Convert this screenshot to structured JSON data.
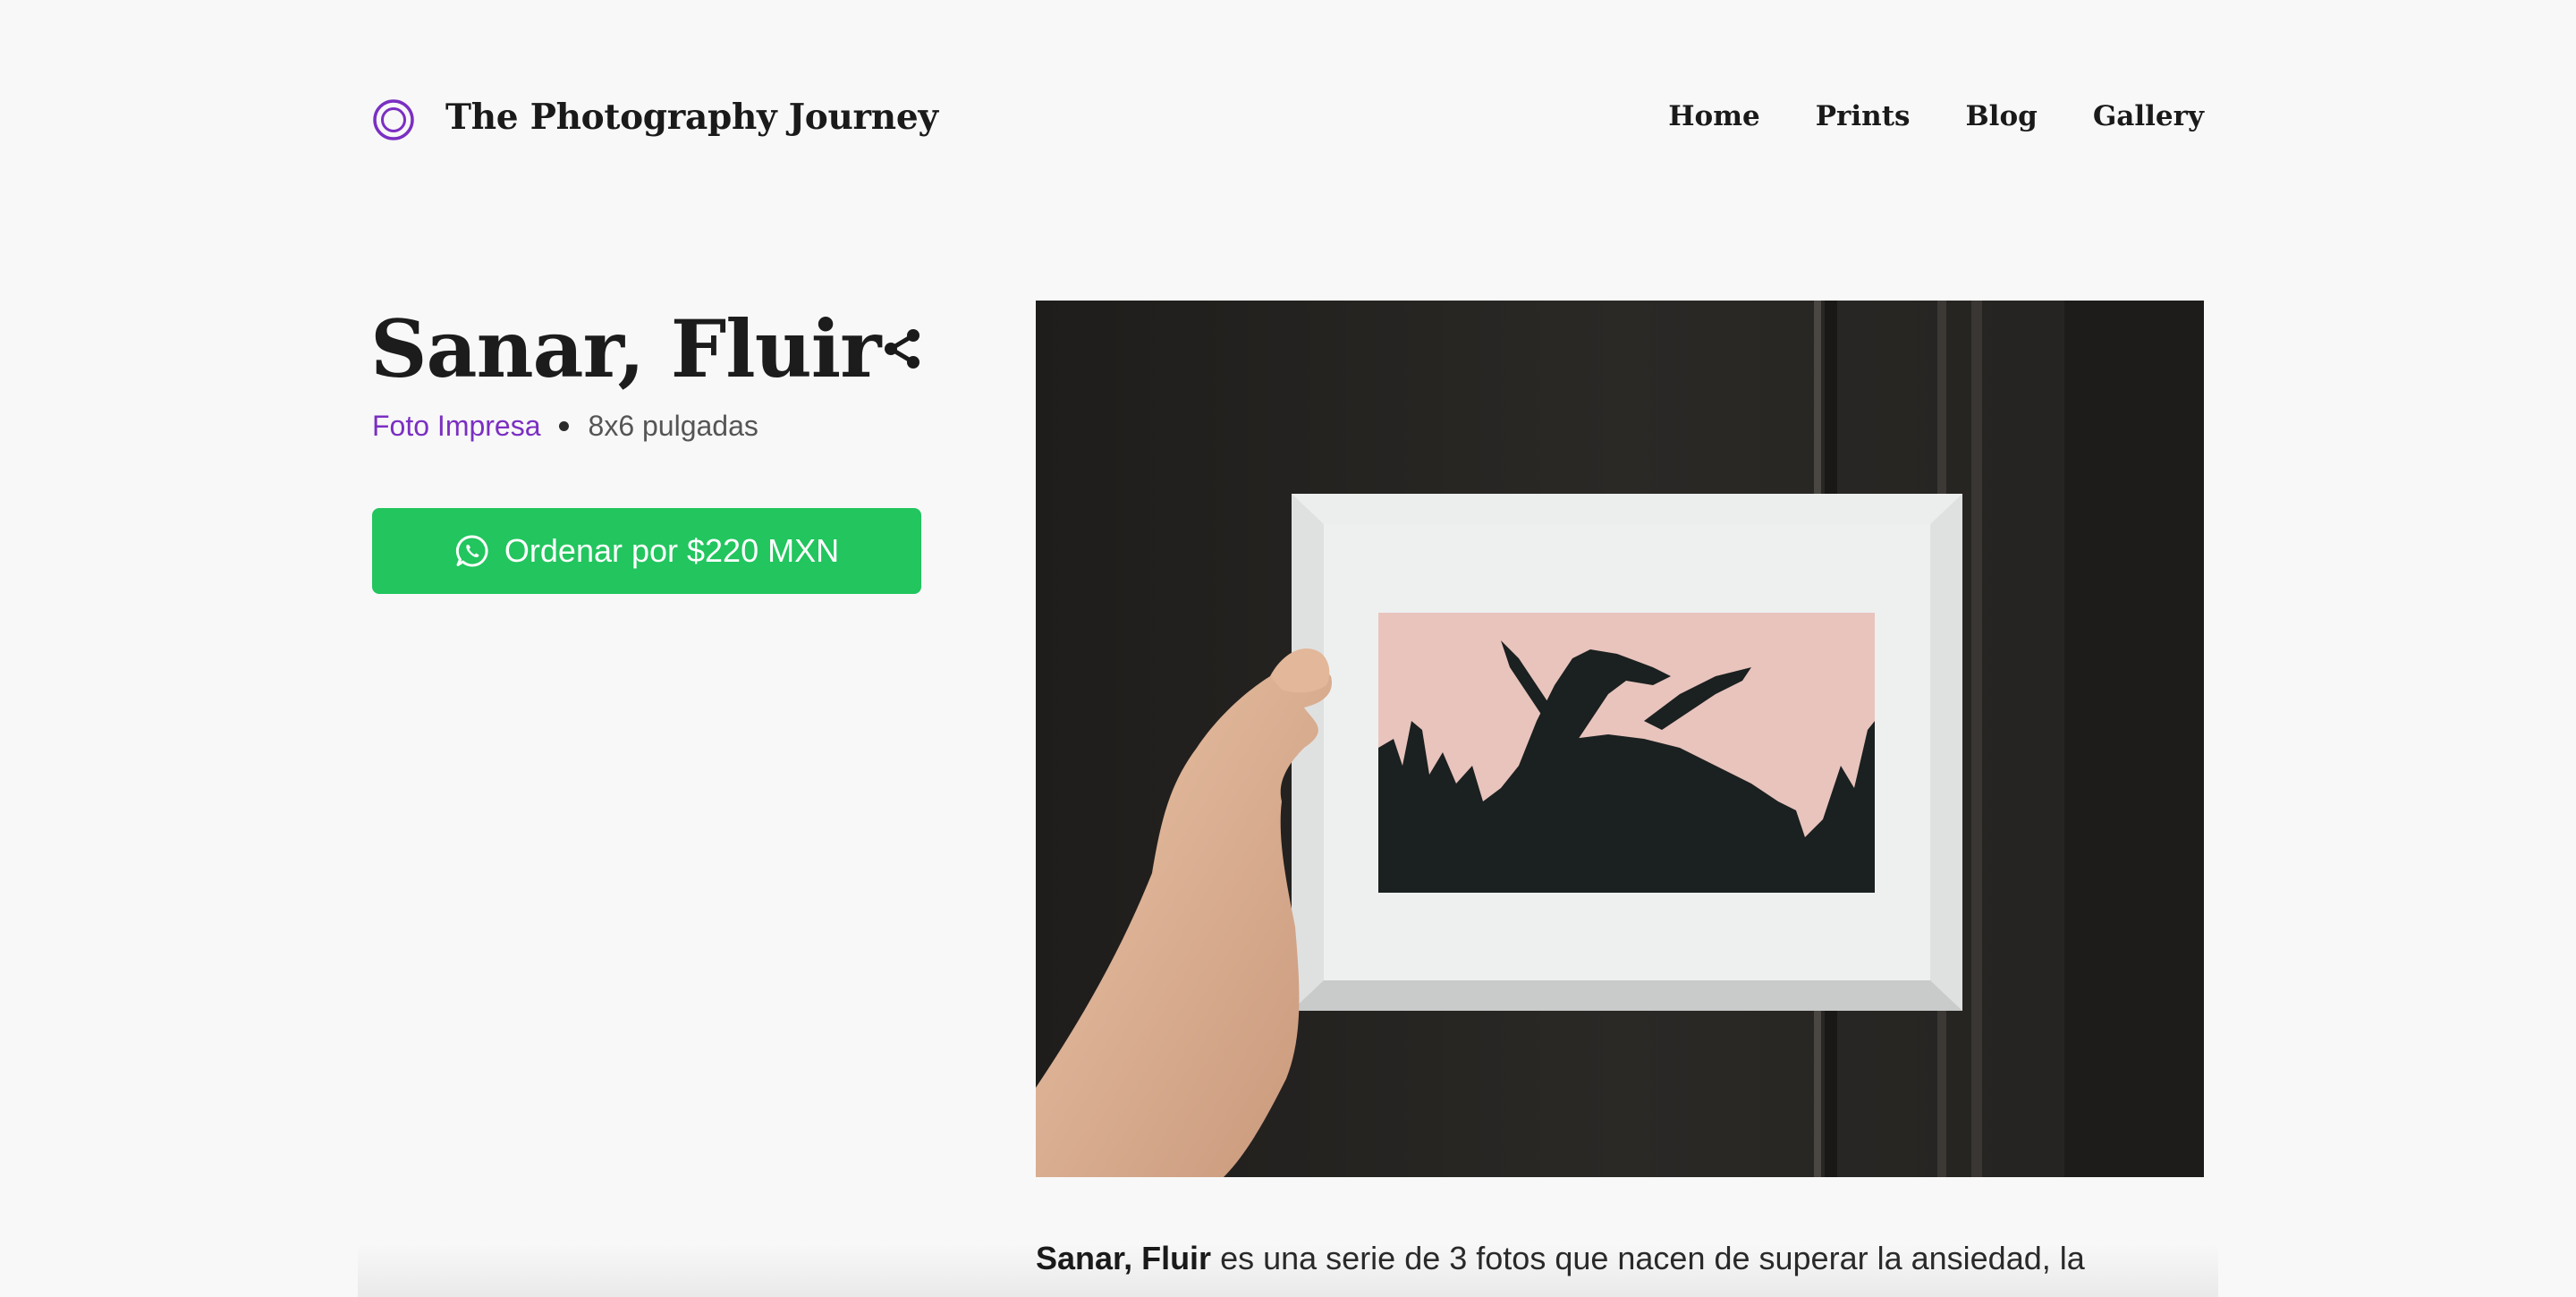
{
  "header": {
    "site_title": "The Photography Journey",
    "logo_icon": "circle-ring-icon",
    "nav": [
      "Home",
      "Prints",
      "Blog",
      "Gallery"
    ]
  },
  "product": {
    "title": "Sanar, Fluir",
    "category": "Foto Impresa",
    "size": "8x6 pulgadas",
    "share_icon": "share-icon",
    "order_label": "Ordenar por $220 MXN",
    "order_icon": "whatsapp-icon",
    "image_alt_icon": "framed-photo"
  },
  "description": {
    "name": "Sanar, Fluir",
    "text": " es una serie de 3 fotos que nacen de superar la ansiedad, la"
  },
  "colors": {
    "accent": "#7b2fc2",
    "button": "#22c55e",
    "background": "#f8f8f8"
  }
}
